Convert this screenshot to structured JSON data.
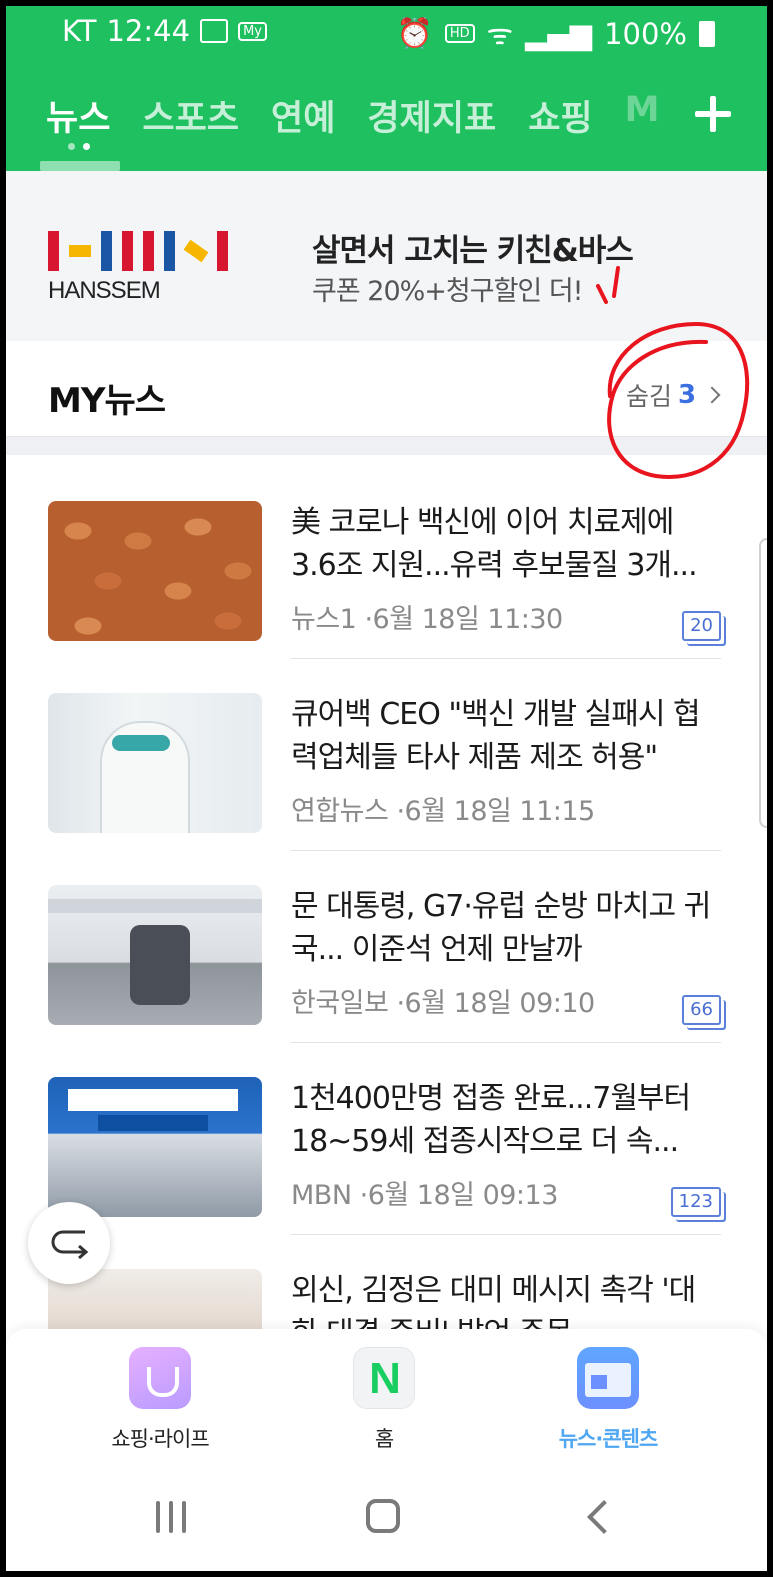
{
  "status_bar": {
    "carrier": "KT",
    "time": "12:44",
    "my_badge": "My",
    "hd_badge": "HD",
    "battery": "100%"
  },
  "tabs": [
    {
      "label": "뉴스"
    },
    {
      "label": "스포츠"
    },
    {
      "label": "연예"
    },
    {
      "label": "경제지표"
    },
    {
      "label": "쇼핑"
    },
    {
      "label": "M"
    }
  ],
  "ad": {
    "brand": "HANSSEM",
    "title": "살면서 고치는 키친&바스",
    "subtitle": "쿠폰 20%+청구할인 더!"
  },
  "my_news": {
    "title": "MY뉴스",
    "hidden_label": "숨김",
    "hidden_count": "3"
  },
  "news": [
    {
      "title": "美 코로나 백신에 이어 치료제에 3.6조 지원...유력 후보물질 3개...",
      "source": "뉴스1",
      "date": "6월 18일 11:30",
      "comments": "20"
    },
    {
      "title": "큐어백 CEO \"백신 개발 실패시 협력업체들 타사 제품 제조 허용\"",
      "source": "연합뉴스",
      "date": "6월 18일 11:15",
      "comments": ""
    },
    {
      "title": "문 대통령, G7·유럽 순방 마치고 귀국... 이준석 언제 만날까",
      "source": "한국일보",
      "date": "6월 18일 09:10",
      "comments": "66"
    },
    {
      "title": "1천400만명 접종 완료...7월부터 18~59세 접종시작으로 더 속...",
      "source": "MBN",
      "date": "6월 18일 09:13",
      "comments": "123"
    },
    {
      "title": "외신, 김정은 대미 메시지 촉각 '대화 대결 준비' 발언 주목",
      "source": "",
      "date": "",
      "comments": ""
    }
  ],
  "bottom_nav": [
    {
      "label": "쇼핑·라이프",
      "icon": "shopping-bag-icon"
    },
    {
      "label": "홈",
      "icon": "naver-n-icon",
      "glyph": "N"
    },
    {
      "label": "뉴스·콘텐츠",
      "icon": "news-card-icon"
    }
  ],
  "colors": {
    "brand_green": "#1fc060",
    "accent_blue": "#3b6fe0",
    "active_nav": "#4fa6f2",
    "annotation_red": "#e8141e"
  }
}
